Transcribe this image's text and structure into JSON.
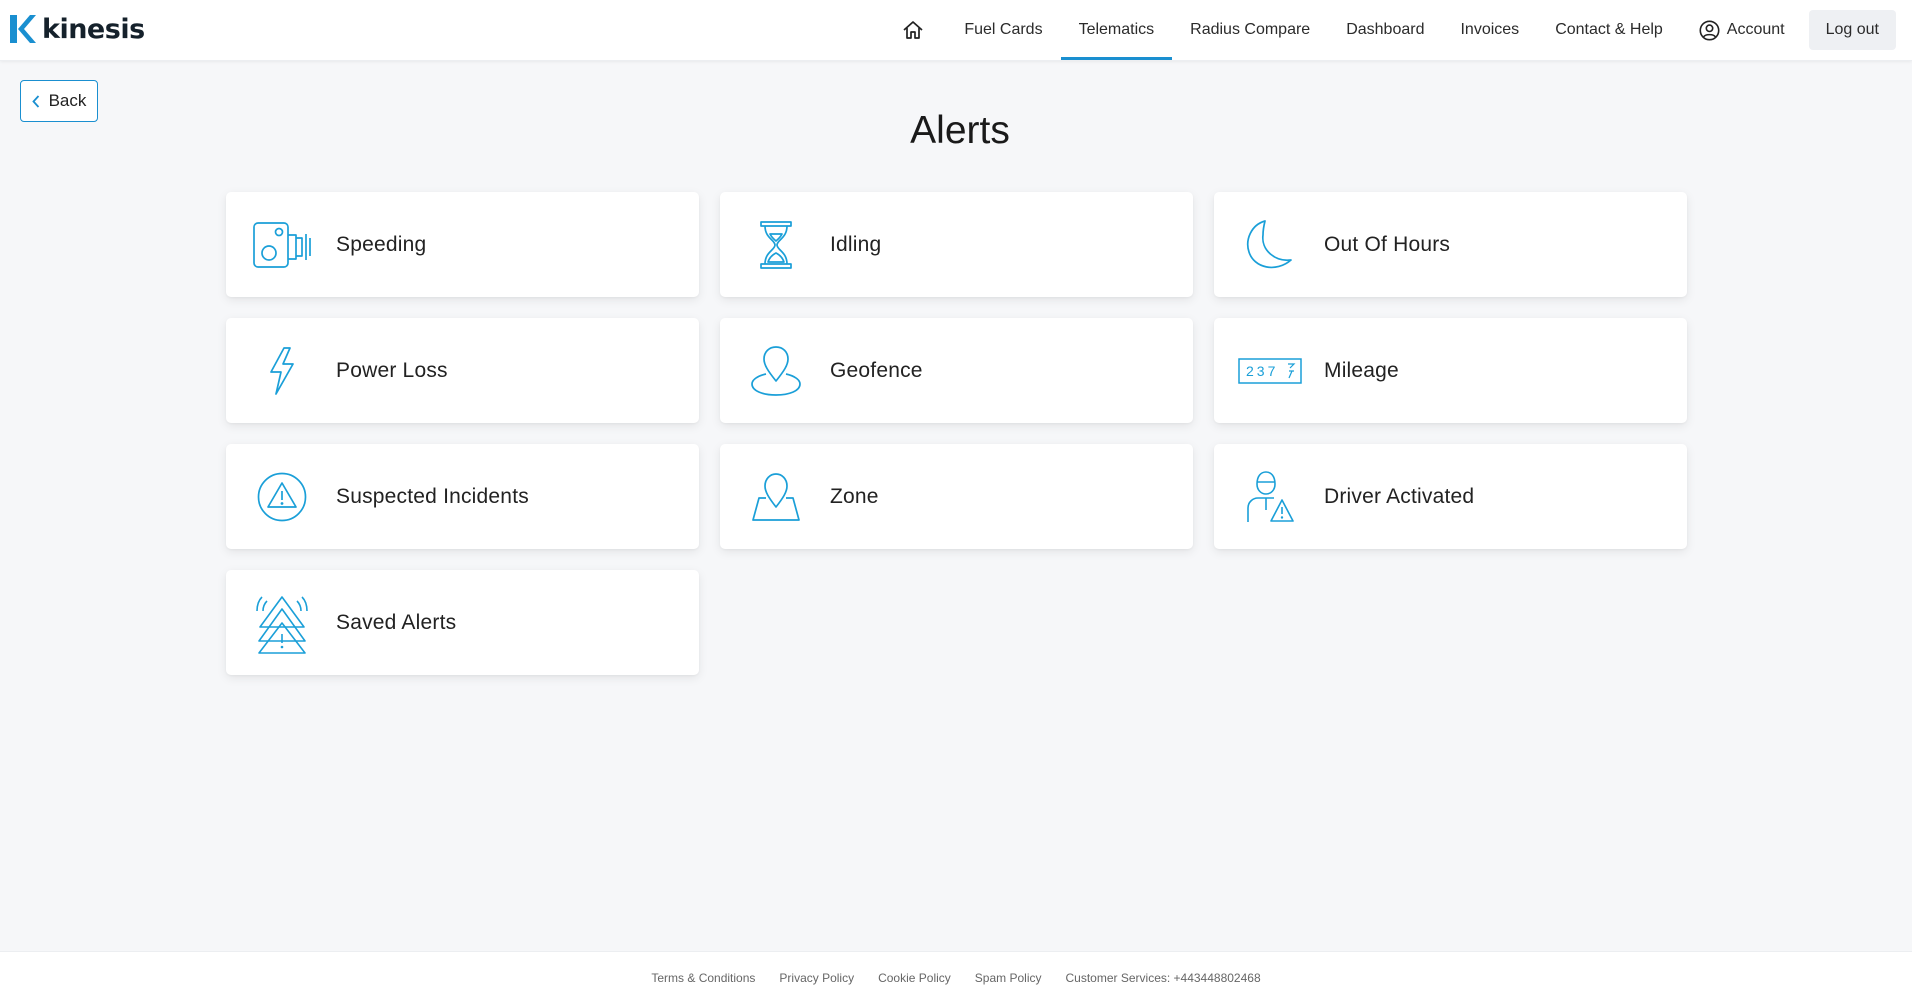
{
  "brand": {
    "name": "kinesis",
    "accent": "#1a8fd0"
  },
  "nav": {
    "home_icon": "home-icon",
    "items": [
      "Fuel Cards",
      "Telematics",
      "Radius Compare",
      "Dashboard",
      "Invoices",
      "Contact & Help"
    ],
    "active": "Telematics",
    "account_label": "Account",
    "logout_label": "Log out"
  },
  "back_label": "Back",
  "title": "Alerts",
  "cards": [
    {
      "label": "Speeding",
      "icon": "speed-camera-icon"
    },
    {
      "label": "Idling",
      "icon": "hourglass-icon"
    },
    {
      "label": "Out Of Hours",
      "icon": "moon-icon"
    },
    {
      "label": "Power Loss",
      "icon": "lightning-icon"
    },
    {
      "label": "Geofence",
      "icon": "geofence-pin-icon"
    },
    {
      "label": "Mileage",
      "icon": "odometer-icon",
      "odometer_text": "237"
    },
    {
      "label": "Suspected Incidents",
      "icon": "warning-circle-icon"
    },
    {
      "label": "Zone",
      "icon": "zone-map-pin-icon"
    },
    {
      "label": "Driver Activated",
      "icon": "driver-warning-icon"
    },
    {
      "label": "Saved Alerts",
      "icon": "stacked-warnings-icon"
    }
  ],
  "footer": {
    "links": [
      "Terms & Conditions",
      "Privacy Policy",
      "Cookie Policy",
      "Spam Policy",
      "Customer Services: +443448802468"
    ]
  }
}
